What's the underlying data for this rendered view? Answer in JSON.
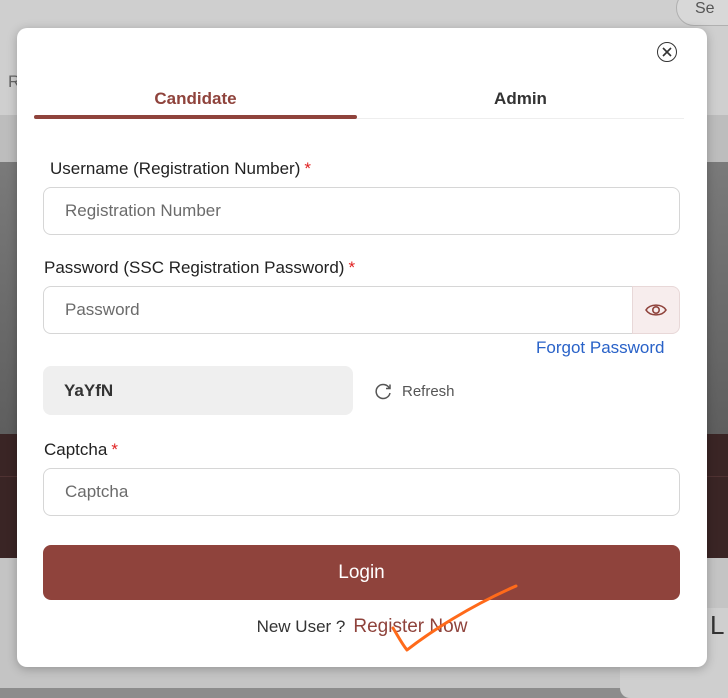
{
  "background": {
    "search_text": "Se",
    "nav_letter": "R",
    "corner_letter": "L"
  },
  "modal": {
    "tabs": [
      {
        "label": "Candidate",
        "active": true
      },
      {
        "label": "Admin",
        "active": false
      }
    ],
    "username": {
      "label": "Username (Registration Number)",
      "required_mark": "*",
      "placeholder": "Registration Number",
      "value": ""
    },
    "password": {
      "label": "Password (SSC Registration Password)",
      "required_mark": "*",
      "placeholder": "Password",
      "value": ""
    },
    "forgot_password": "Forgot Password",
    "captcha_code": "YaYfN",
    "refresh_label": "Refresh",
    "captcha": {
      "label": "Captcha",
      "required_mark": "*",
      "placeholder": "Captcha",
      "value": ""
    },
    "login_label": "Login",
    "new_user_text": "New User ?",
    "register_label": "Register Now"
  },
  "colors": {
    "accent": "#8f433c",
    "link": "#2962c8",
    "required": "#e02020",
    "annotation": "#ff6a1a"
  },
  "icons": [
    "close-icon",
    "eye-icon",
    "refresh-icon"
  ]
}
